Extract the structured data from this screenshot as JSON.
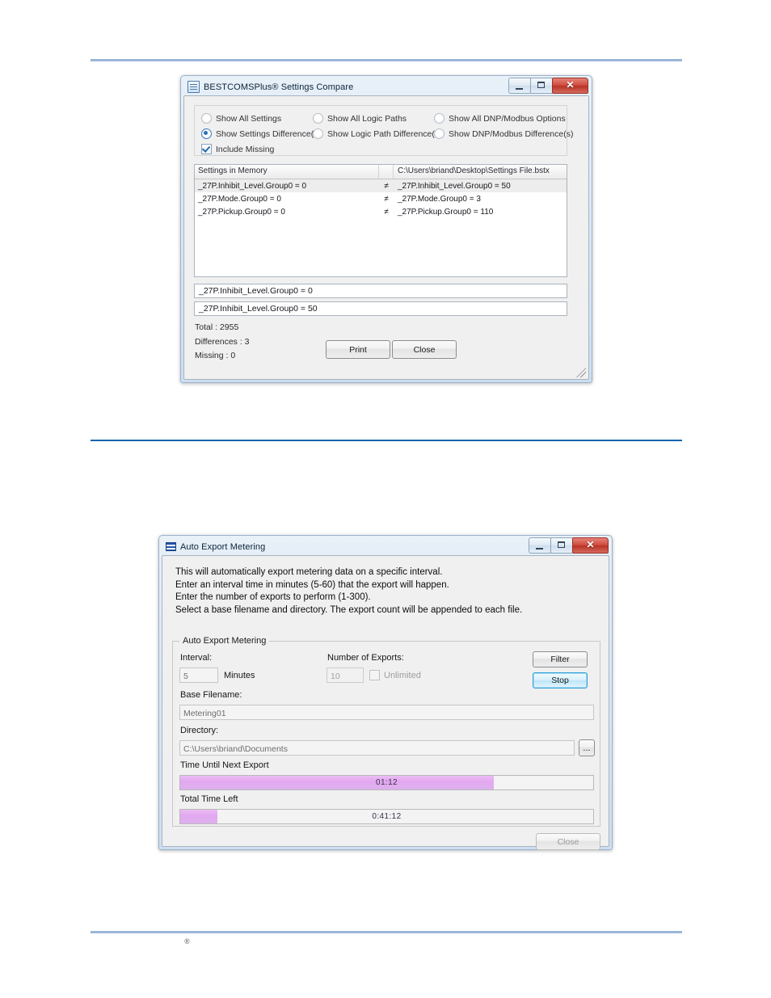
{
  "page": {
    "footer_mark": "®"
  },
  "dialog_compare": {
    "title": "BESTCOMSPlus® Settings Compare",
    "icon": "document-icon",
    "window_buttons": {
      "minimize": "",
      "maximize": "",
      "close": "✕"
    },
    "options": {
      "show_all_settings": "Show All Settings",
      "show_settings_differences": "Show Settings Difference(s)",
      "include_missing": "Include Missing",
      "show_all_logic_paths": "Show All Logic Paths",
      "show_logic_path_differences": "Show Logic Path Difference(s)",
      "show_all_dnp_modbus": "Show All DNP/Modbus Options",
      "show_dnp_modbus_differences": "Show DNP/Modbus Difference(s)"
    },
    "table": {
      "header_left": "Settings in Memory",
      "header_mid": "",
      "header_right": "C:\\Users\\briand\\Desktop\\Settings File.bstx",
      "rows": [
        {
          "left": "_27P.Inhibit_Level.Group0 = 0",
          "op": "≠",
          "right": "_27P.Inhibit_Level.Group0 = 50"
        },
        {
          "left": "_27P.Mode.Group0 = 0",
          "op": "≠",
          "right": "_27P.Mode.Group0 = 3"
        },
        {
          "left": "_27P.Pickup.Group0 = 0",
          "op": "≠",
          "right": "_27P.Pickup.Group0 = 110"
        }
      ]
    },
    "detail_memory": "_27P.Inhibit_Level.Group0 = 0",
    "detail_file": "_27P.Inhibit_Level.Group0 = 50",
    "stats": {
      "total": "Total : 2955",
      "differences": "Differences : 3",
      "missing": "Missing : 0"
    },
    "buttons": {
      "print": "Print",
      "close": "Close"
    }
  },
  "dialog_export": {
    "title": "Auto Export Metering",
    "icon": "list-lines-icon",
    "window_buttons": {
      "minimize": "",
      "maximize": "",
      "close": "✕"
    },
    "description": "This will automatically export metering data on a specific interval.\nEnter an interval time in minutes (5-60) that the export will happen.\nEnter the number of exports to perform (1-300).\nSelect a base filename and directory. The export count will be appended to each file.",
    "group_title": "Auto Export Metering",
    "interval_label": "Interval:",
    "interval_value": "5",
    "minutes_label": "Minutes",
    "number_of_exports_label": "Number of Exports:",
    "number_of_exports_value": "10",
    "unlimited_label": "Unlimited",
    "base_filename_label": "Base Filename:",
    "base_filename_value": "Metering01",
    "directory_label": "Directory:",
    "directory_value": "C:\\Users\\briand\\Documents",
    "browse_label": "...",
    "time_until_next_export_label": "Time Until Next Export",
    "time_until_next_export_value": "01:12",
    "time_until_next_export_percent": 76,
    "total_time_left_label": "Total Time Left",
    "total_time_left_value": "0:41:12",
    "total_time_left_percent": 9,
    "buttons": {
      "filter": "Filter",
      "stop": "Stop",
      "close": "Close"
    }
  },
  "colors": {
    "rule_light": "#9cb6d8",
    "rule_dark": "#0065ad",
    "progress_fill": "#e3a8f0",
    "focus_blue": "#2f9ddb"
  }
}
